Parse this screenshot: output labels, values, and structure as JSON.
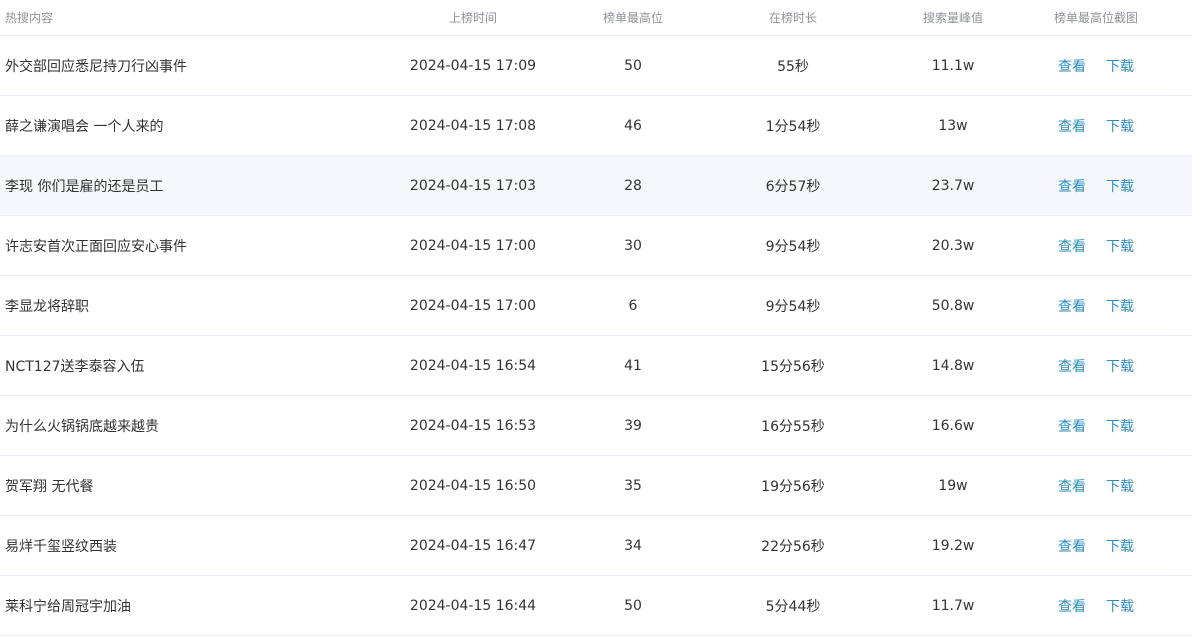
{
  "headers": {
    "title": "热搜内容",
    "time": "上榜时间",
    "rank": "榜单最高位",
    "duration": "在榜时长",
    "peak": "搜索量峰值",
    "screenshot": "榜单最高位截图"
  },
  "actions": {
    "view": "查看",
    "download": "下载"
  },
  "colors": {
    "link": "#2a8fbd",
    "header_text": "#909399",
    "row_highlight": "#f5f7fa"
  },
  "rows": [
    {
      "title": "外交部回应悉尼持刀行凶事件",
      "time": "2024-04-15 17:09",
      "rank": "50",
      "duration": "55秒",
      "peak": "11.1w"
    },
    {
      "title": "薛之谦演唱会 一个人来的",
      "time": "2024-04-15 17:08",
      "rank": "46",
      "duration": "1分54秒",
      "peak": "13w"
    },
    {
      "title": "李现 你们是雇的还是员工",
      "time": "2024-04-15 17:03",
      "rank": "28",
      "duration": "6分57秒",
      "peak": "23.7w"
    },
    {
      "title": "许志安首次正面回应安心事件",
      "time": "2024-04-15 17:00",
      "rank": "30",
      "duration": "9分54秒",
      "peak": "20.3w"
    },
    {
      "title": "李显龙将辞职",
      "time": "2024-04-15 17:00",
      "rank": "6",
      "duration": "9分54秒",
      "peak": "50.8w"
    },
    {
      "title": "NCT127送李泰容入伍",
      "time": "2024-04-15 16:54",
      "rank": "41",
      "duration": "15分56秒",
      "peak": "14.8w"
    },
    {
      "title": "为什么火锅锅底越来越贵",
      "time": "2024-04-15 16:53",
      "rank": "39",
      "duration": "16分55秒",
      "peak": "16.6w"
    },
    {
      "title": "贺军翔 无代餐",
      "time": "2024-04-15 16:50",
      "rank": "35",
      "duration": "19分56秒",
      "peak": "19w"
    },
    {
      "title": "易烊千玺竖纹西装",
      "time": "2024-04-15 16:47",
      "rank": "34",
      "duration": "22分56秒",
      "peak": "19.2w"
    },
    {
      "title": "莱科宁给周冠宇加油",
      "time": "2024-04-15 16:44",
      "rank": "50",
      "duration": "5分44秒",
      "peak": "11.7w"
    }
  ]
}
